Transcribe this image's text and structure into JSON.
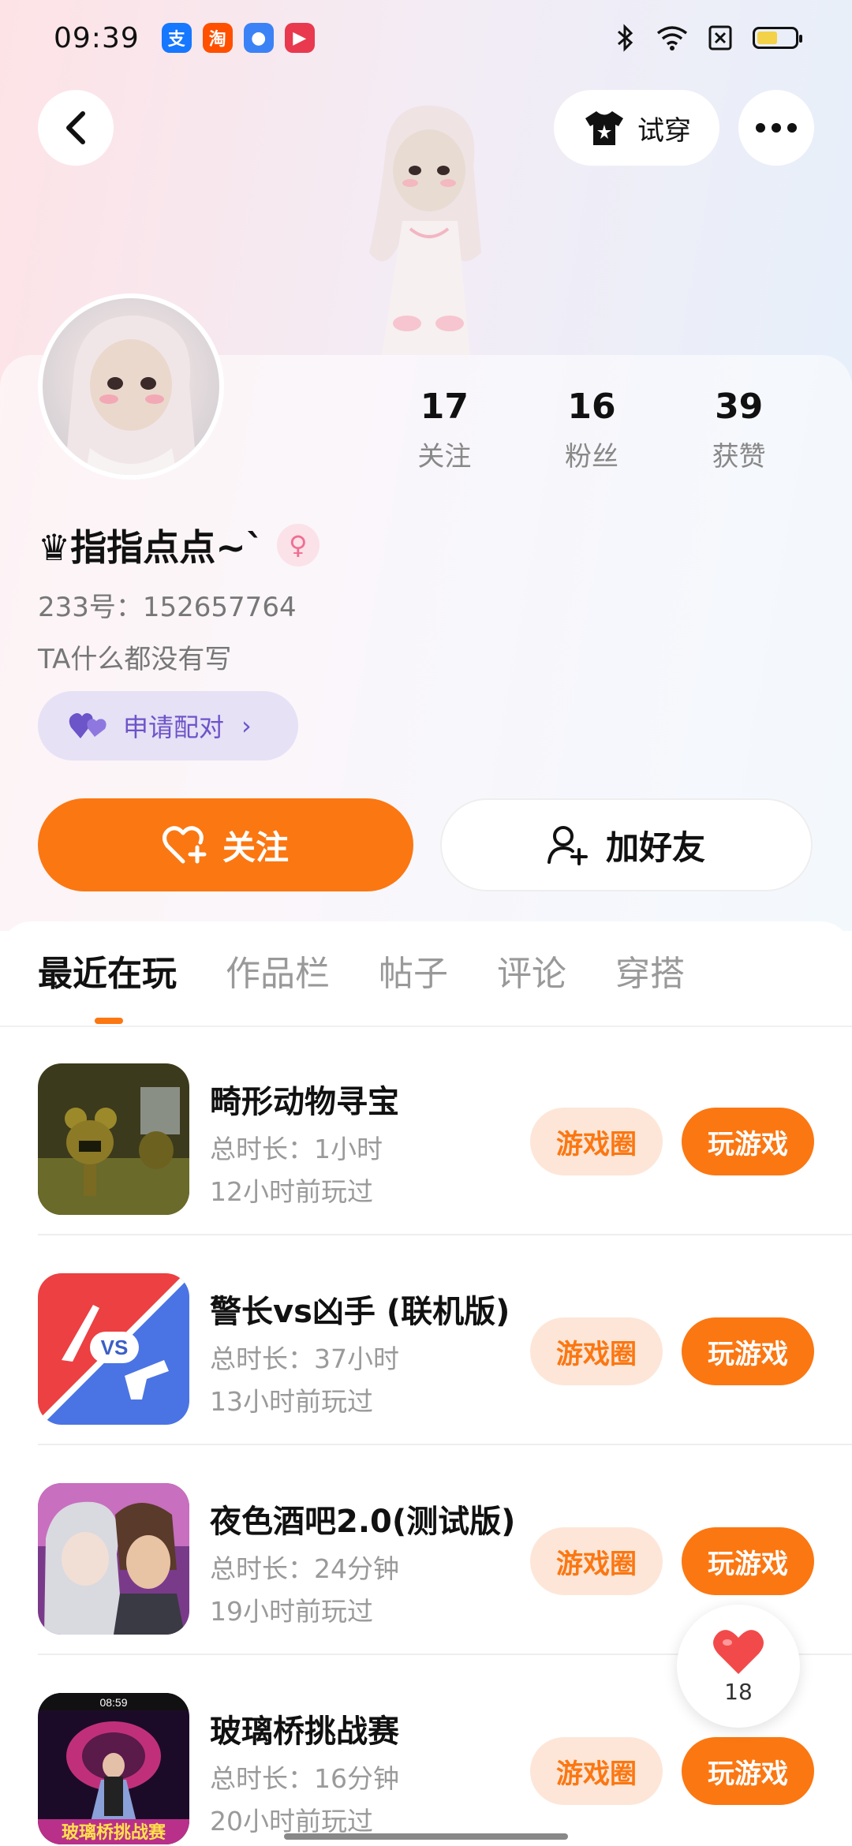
{
  "status_bar": {
    "time": "09:39",
    "apps": [
      {
        "icon": "alipay-icon",
        "glyph": "支",
        "color": "#1677ff"
      },
      {
        "icon": "taobao-icon",
        "glyph": "淘",
        "color": "#ff5000"
      },
      {
        "icon": "chat-bubble-icon",
        "glyph": "●",
        "color": "#3b82f6"
      },
      {
        "icon": "video-icon",
        "glyph": "▶",
        "color": "#e8394f"
      }
    ],
    "battery_level": 0.55
  },
  "header": {
    "tryon_label": "试穿"
  },
  "profile": {
    "stats": [
      {
        "value": "17",
        "label": "关注"
      },
      {
        "value": "16",
        "label": "粉丝"
      },
      {
        "value": "39",
        "label": "获赞"
      }
    ],
    "username": "♛指指点点~`",
    "uid": "233号：152657764",
    "bio": "TA什么都没有写",
    "pair_label": "申请配对",
    "pair_chevron": "›"
  },
  "actions": {
    "follow_label": "关注",
    "add_friend_label": "加好友"
  },
  "tabs": [
    {
      "label": "最近在玩",
      "active": true
    },
    {
      "label": "作品栏",
      "active": false
    },
    {
      "label": "帖子",
      "active": false
    },
    {
      "label": "评论",
      "active": false
    },
    {
      "label": "穿搭",
      "active": false
    }
  ],
  "games": [
    {
      "title": "畸形动物寻宝",
      "duration": "总时长：1小时",
      "last_played": "12小时前玩过",
      "circle_label": "游戏圈",
      "play_label": "玩游戏"
    },
    {
      "title": "警长vs凶手 (联机版)",
      "duration": "总时长：37小时",
      "last_played": "13小时前玩过",
      "circle_label": "游戏圈",
      "play_label": "玩游戏"
    },
    {
      "title": "夜色酒吧2.0(测试版)",
      "duration": "总时长：24分钟",
      "last_played": "19小时前玩过",
      "circle_label": "游戏圈",
      "play_label": "玩游戏"
    },
    {
      "title": "玻璃桥挑战赛",
      "duration": "总时长：16分钟",
      "last_played": "20小时前玩过",
      "circle_label": "游戏圈",
      "play_label": "玩游戏"
    }
  ],
  "game_icon_texts": {
    "vs": "VS",
    "glass_bridge_banner": "玻璃桥挑战赛",
    "glass_bridge_timer": "08:59"
  },
  "like_float": {
    "count": "18"
  },
  "colors": {
    "accent": "#fb7712",
    "accent_soft": "#fde6d8",
    "pair_purple": "#6c54c9",
    "gender_pink": "#ef6f93"
  }
}
